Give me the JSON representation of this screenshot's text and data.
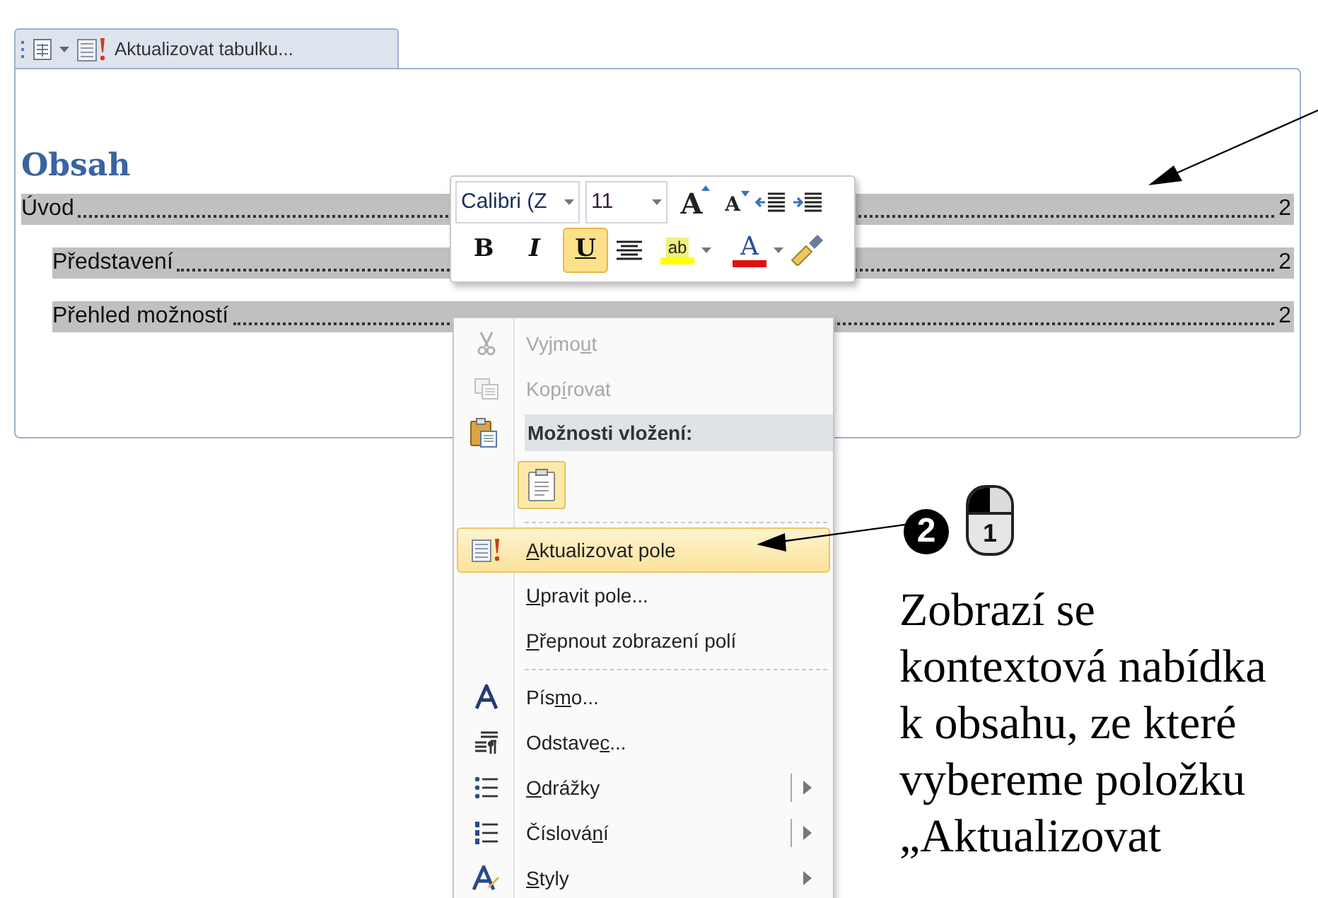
{
  "field_tab": {
    "label": "Aktualizovat tabulku..."
  },
  "document": {
    "heading": "Obsah",
    "toc": [
      {
        "title": "Úvod",
        "page": "2",
        "children": [
          {
            "title": "Představení",
            "page": "2"
          },
          {
            "title": "Přehled možností",
            "page": "2"
          }
        ]
      }
    ]
  },
  "mini_toolbar": {
    "font": "Calibri (Z",
    "size": "11",
    "grow": "A",
    "shrink": "A",
    "buttons": [
      {
        "label": "B",
        "selected": false
      },
      {
        "label": "I",
        "selected": false
      },
      {
        "label": "U",
        "selected": true
      }
    ],
    "highlight": "ab",
    "font_color": "A"
  },
  "context_menu": [
    {
      "kind": "item",
      "label": [
        {
          "text": "Vyjmo",
          "underlined": false
        },
        {
          "text": "u",
          "underlined": true
        },
        {
          "text": "t",
          "underlined": false
        }
      ],
      "disabled": true,
      "selected": false,
      "submenu": false,
      "split": false
    },
    {
      "kind": "item",
      "label": [
        {
          "text": "Kop",
          "underlined": false
        },
        {
          "text": "í",
          "underlined": true
        },
        {
          "text": "rovat",
          "underlined": false
        }
      ],
      "disabled": true,
      "selected": false,
      "submenu": false,
      "split": false
    },
    {
      "kind": "header",
      "label": [
        {
          "text": "Možnosti vložení:",
          "underlined": false
        }
      ]
    },
    {
      "kind": "paste_options"
    },
    {
      "kind": "separator"
    },
    {
      "kind": "item",
      "label": [
        {
          "text": "A",
          "underlined": true
        },
        {
          "text": "ktualizovat pole",
          "underlined": false
        }
      ],
      "disabled": false,
      "selected": true,
      "submenu": false,
      "split": false
    },
    {
      "kind": "item",
      "label": [
        {
          "text": "U",
          "underlined": true
        },
        {
          "text": "pravit pole...",
          "underlined": false
        }
      ],
      "disabled": false,
      "selected": false,
      "submenu": false,
      "split": false
    },
    {
      "kind": "item",
      "label": [
        {
          "text": "P",
          "underlined": true
        },
        {
          "text": "řepnout zobrazení polí",
          "underlined": false
        }
      ],
      "disabled": false,
      "selected": false,
      "submenu": false,
      "split": false
    },
    {
      "kind": "separator"
    },
    {
      "kind": "item",
      "label": [
        {
          "text": "Pís",
          "underlined": false
        },
        {
          "text": "m",
          "underlined": true
        },
        {
          "text": "o...",
          "underlined": false
        }
      ],
      "disabled": false,
      "selected": false,
      "submenu": false,
      "split": false
    },
    {
      "kind": "item",
      "label": [
        {
          "text": "Odstave",
          "underlined": false
        },
        {
          "text": "c",
          "underlined": true
        },
        {
          "text": "...",
          "underlined": false
        }
      ],
      "disabled": false,
      "selected": false,
      "submenu": false,
      "split": false
    },
    {
      "kind": "item",
      "label": [
        {
          "text": "O",
          "underlined": true
        },
        {
          "text": "drážky",
          "underlined": false
        }
      ],
      "disabled": false,
      "selected": false,
      "submenu": true,
      "split": true
    },
    {
      "kind": "item",
      "label": [
        {
          "text": "Číslová",
          "underlined": false
        },
        {
          "text": "n",
          "underlined": true
        },
        {
          "text": "í",
          "underlined": false
        }
      ],
      "disabled": false,
      "selected": false,
      "submenu": true,
      "split": true
    },
    {
      "kind": "item",
      "label": [
        {
          "text": "S",
          "underlined": true
        },
        {
          "text": "tyly",
          "underlined": false
        }
      ],
      "disabled": false,
      "selected": false,
      "submenu": true,
      "split": false
    }
  ],
  "annotation": {
    "step": "2",
    "mouse_button": "1",
    "text_lines": [
      "Zobrazí se",
      "kontextová nabídka",
      "k obsahu, ze které",
      "vybereme položku",
      "„Aktualizovat"
    ]
  }
}
